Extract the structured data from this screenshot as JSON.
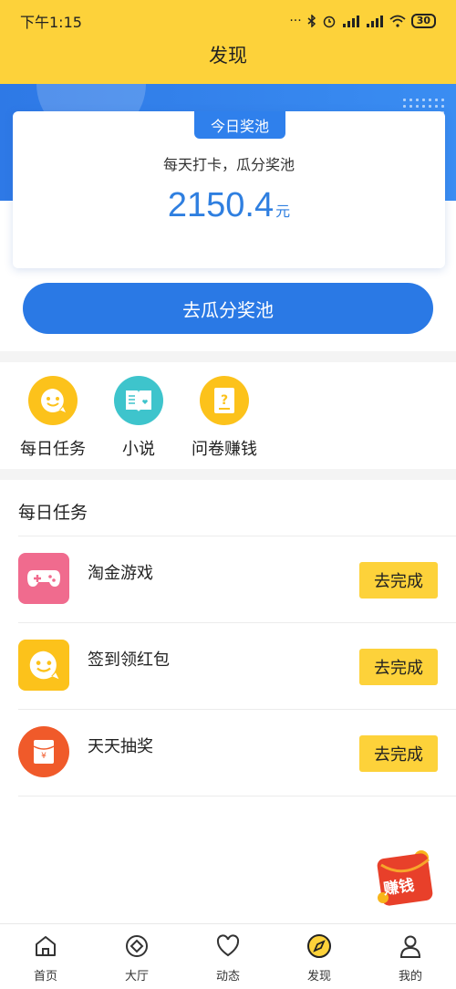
{
  "status_bar": {
    "time": "下午1:15",
    "battery": "30"
  },
  "header": {
    "title": "发现"
  },
  "pool": {
    "tag": "今日奖池",
    "subtitle": "每天打卡，瓜分奖池",
    "amount": "2150.4",
    "unit": "元",
    "button_label": "去瓜分奖池"
  },
  "quick_links": [
    {
      "label": "每日任务",
      "icon": "smile-bubble-icon",
      "color": "#fcc21b"
    },
    {
      "label": "小说",
      "icon": "book-icon",
      "color": "#3ec4cc"
    },
    {
      "label": "问卷赚钱",
      "icon": "questionnaire-icon",
      "color": "#fcc21b"
    }
  ],
  "tasks": {
    "title": "每日任务",
    "items": [
      {
        "name": "淘金游戏",
        "button": "去完成",
        "icon": "gamepad-icon",
        "color": "#f06b8e"
      },
      {
        "name": "签到领红包",
        "button": "去完成",
        "icon": "smile-bubble-icon",
        "color": "#fcc21b"
      },
      {
        "name": "天天抽奖",
        "button": "去完成",
        "icon": "red-envelope-icon",
        "color": "#f05a2a"
      }
    ]
  },
  "earn_badge": {
    "label": "赚钱"
  },
  "nav": [
    {
      "label": "首页",
      "icon": "home-icon"
    },
    {
      "label": "大厅",
      "icon": "hall-icon"
    },
    {
      "label": "动态",
      "icon": "heart-icon"
    },
    {
      "label": "发现",
      "icon": "compass-icon"
    },
    {
      "label": "我的",
      "icon": "user-icon"
    }
  ],
  "colors": {
    "accent_yellow": "#fdd23a",
    "accent_blue": "#2a79e5"
  }
}
